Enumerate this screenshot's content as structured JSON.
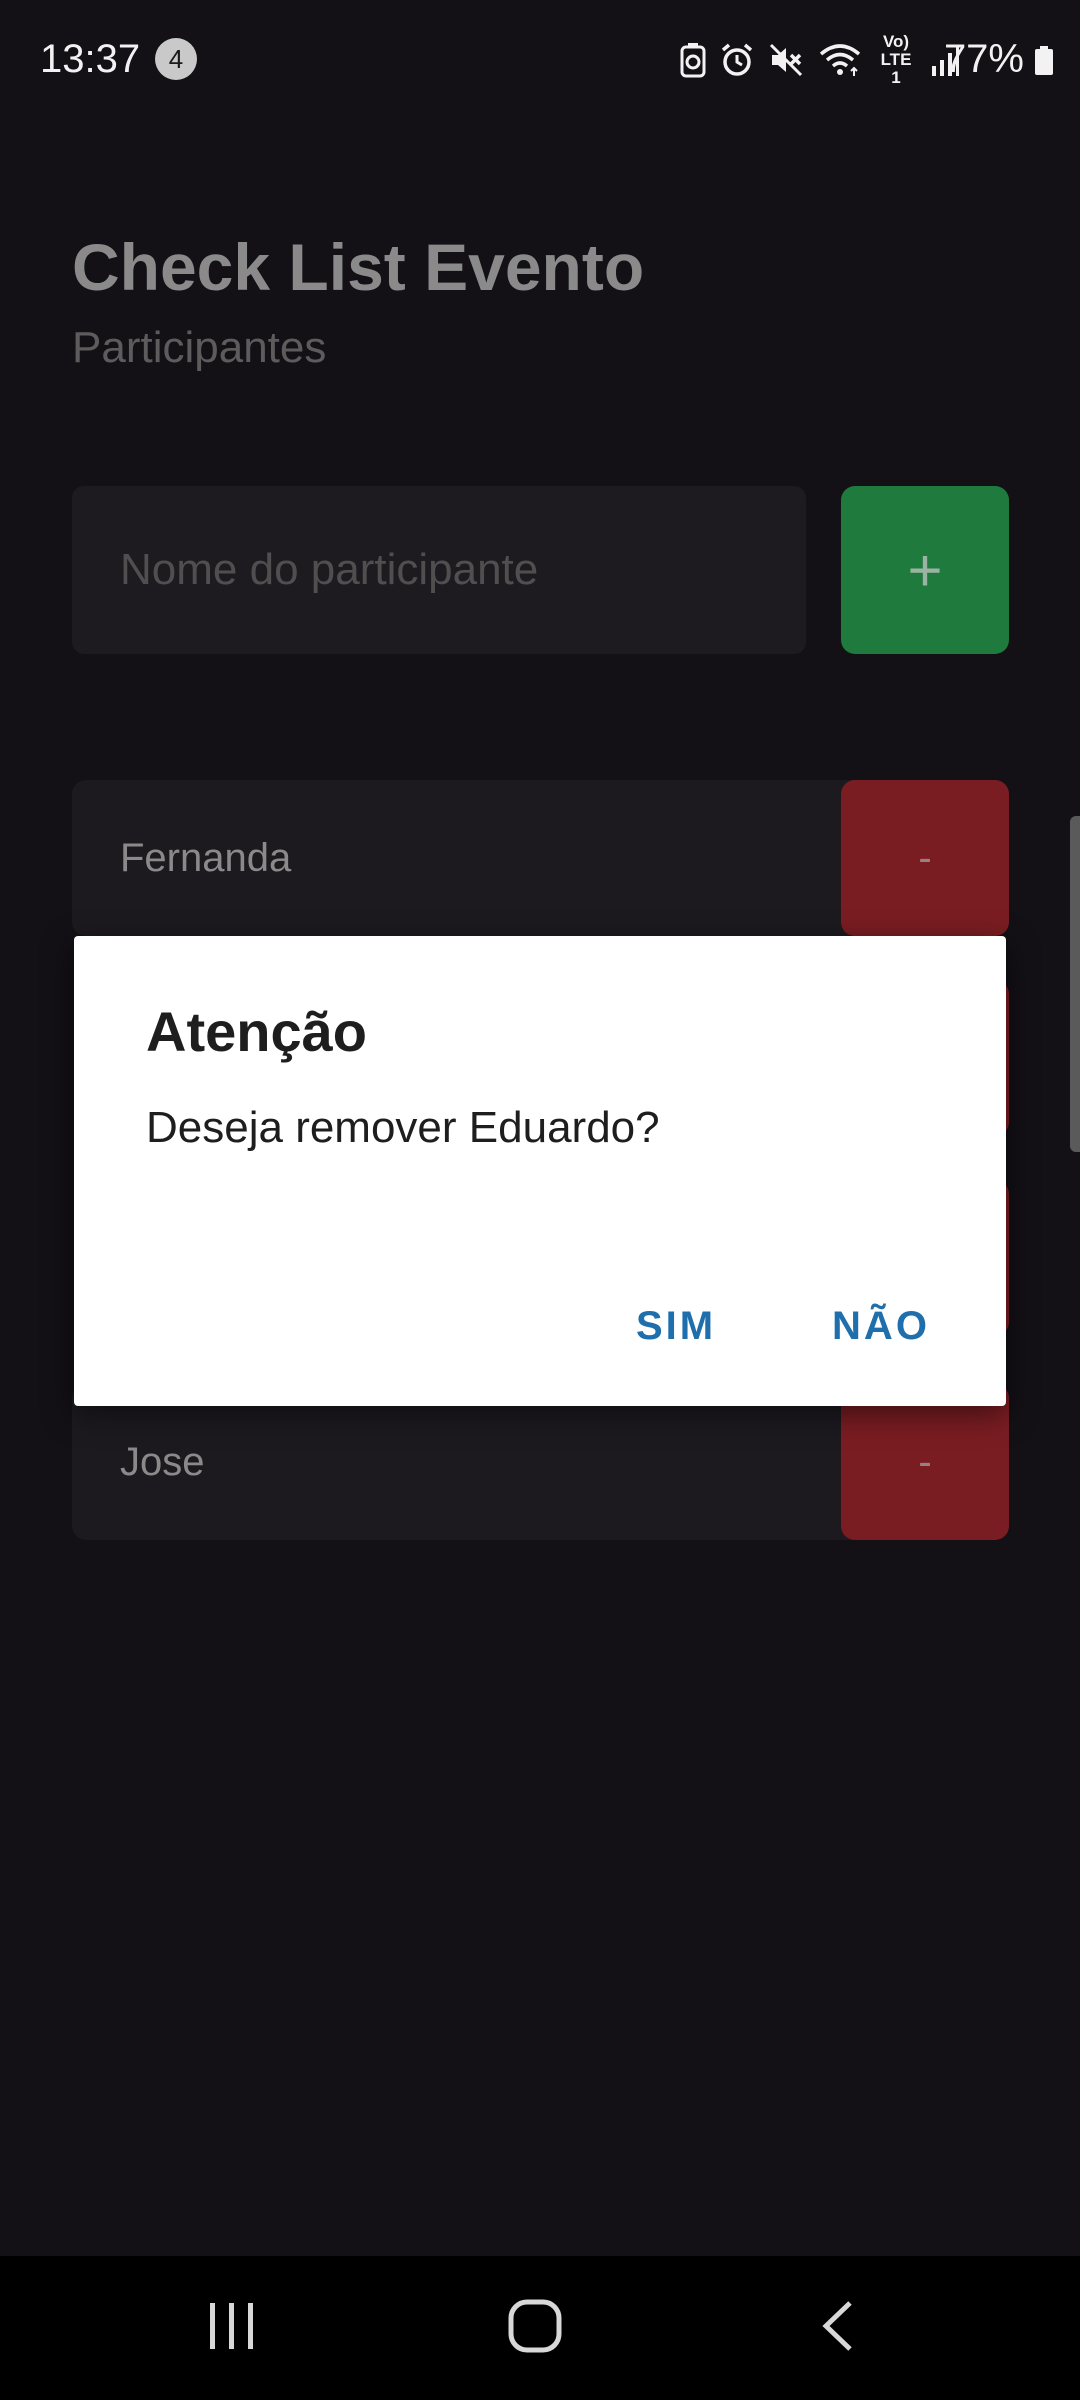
{
  "status_bar": {
    "time": "13:37",
    "notification_count": "4",
    "network_label": "Vo) LTE1",
    "battery_percent": "77%"
  },
  "app": {
    "title": "Check List Evento",
    "subtitle": "Participantes",
    "input_placeholder": "Nome do participante",
    "add_button_label": "+",
    "remove_button_label": "-",
    "participants": [
      {
        "name": "Fernanda"
      },
      {
        "name": "Jose"
      }
    ]
  },
  "dialog": {
    "title": "Atenção",
    "message": "Deseja remover Eduardo?",
    "confirm_label": "SIM",
    "cancel_label": "NÃO"
  },
  "colors": {
    "background": "#131016",
    "add_button": "#1f7a3d",
    "remove_button": "#7a1d22",
    "dialog_accent": "#1f6fad"
  },
  "icons": {
    "status": [
      "battery-saver-icon",
      "alarm-icon",
      "mute-icon",
      "wifi-icon",
      "signal-icon",
      "battery-icon"
    ],
    "nav": [
      "recents-icon",
      "home-icon",
      "back-icon"
    ]
  }
}
